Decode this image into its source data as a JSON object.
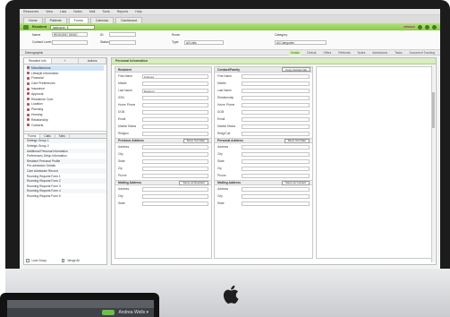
{
  "menubar": [
    "Resources",
    "View",
    "Lists",
    "Notes",
    "Mail",
    "Tools",
    "Reports",
    "Help"
  ],
  "tabs": [
    {
      "label": "Home",
      "active": false
    },
    {
      "label": "Patients",
      "active": false
    },
    {
      "label": "Forms",
      "active": true
    },
    {
      "label": "Calendar",
      "active": false
    },
    {
      "label": "Dashboard",
      "active": false
    }
  ],
  "greenbar": {
    "title": "Resident",
    "input": "lastname, fi",
    "logo": "edvisor"
  },
  "header": {
    "name_label": "Name",
    "name_value": "RESIDENT DEMO",
    "contact_label": "Contact Level",
    "id_label": "ID",
    "status_label": "Status",
    "room_label": "Room",
    "type_label": "Type",
    "type_value": "All Units",
    "cat_label": "Category",
    "cat_value": "All Categories"
  },
  "subtabs": {
    "label": "Demographic",
    "right": [
      {
        "label": "Details",
        "sel": true
      },
      {
        "label": "Clinical",
        "sel": false
      },
      {
        "label": "Offers",
        "sel": false
      },
      {
        "label": "Referrals",
        "sel": false
      },
      {
        "label": "Notes",
        "sel": false
      },
      {
        "label": "Admissions",
        "sel": false
      },
      {
        "label": "Tasks",
        "sel": false
      },
      {
        "label": "Document Tracking",
        "sel": false
      }
    ]
  },
  "sidebar": {
    "tabs": [
      "Resident Info",
      "+",
      "Actions"
    ],
    "items": [
      {
        "label": "Miscellaneous",
        "sel": true
      },
      {
        "label": "Lifestyle Information",
        "sel": false
      },
      {
        "label": "Financial",
        "sel": false
      },
      {
        "label": "Care Preferences",
        "sel": false
      },
      {
        "label": "Insurance",
        "sel": false
      },
      {
        "label": "Approval",
        "sel": false
      },
      {
        "label": "Residence Cont.",
        "sel": false
      },
      {
        "label": "Location",
        "sel": false
      },
      {
        "label": "Planning",
        "sel": false
      },
      {
        "label": "Housing",
        "sel": false
      },
      {
        "label": "Relationship",
        "sel": false
      },
      {
        "label": "Contacts",
        "sel": false
      }
    ],
    "tabs2": [
      "Forms",
      "Calls",
      "Tabs"
    ],
    "rows": [
      "Settings Group 1",
      "Settings Group 2",
      "Additional Personal Information",
      "Preferences Setup Information",
      "Resident Personal Profile",
      "Pre-admission Details",
      "Care Admission Record",
      "Rooming Request Form 1",
      "Rooming Request Form 2",
      "Rooming Request Form 3",
      "Rooming Request Form 4",
      "Rooming Request Form 5"
    ],
    "foot_left": "Lock Group",
    "foot_right": "Merge All"
  },
  "main": {
    "title": "Personal Information",
    "panes": [
      {
        "head": "Resident",
        "btn": "",
        "fields": [
          {
            "k": "First Name",
            "v": "Frances"
          },
          {
            "k": "Middle",
            "v": ""
          },
          {
            "k": "Last Name",
            "v": "Rayburn"
          },
          {
            "k": "SSN",
            "v": ""
          },
          {
            "k": "Home Phone",
            "v": ""
          },
          {
            "k": "DOB",
            "v": ""
          },
          {
            "k": "Email",
            "v": ""
          },
          {
            "k": "Marital Status",
            "v": ""
          },
          {
            "k": "Religion",
            "v": ""
          }
        ],
        "sect1": "Previous Address",
        "sect1_btn": "Move Out Date",
        "fields2": [
          {
            "k": "Address",
            "v": ""
          },
          {
            "k": "City",
            "v": ""
          },
          {
            "k": "State",
            "v": ""
          },
          {
            "k": "Zip",
            "v": ""
          },
          {
            "k": "Phone",
            "v": ""
          }
        ],
        "sect2": "Mailing Address",
        "sect2_btn": "Same as Resident",
        "fields3": [
          {
            "k": "Address",
            "v": ""
          },
          {
            "k": "City",
            "v": ""
          },
          {
            "k": "State",
            "v": ""
          }
        ]
      },
      {
        "head": "Contact/Family",
        "btn": "Copy Contact Info",
        "fields": [
          {
            "k": "First Name",
            "v": ""
          },
          {
            "k": "Middle",
            "v": ""
          },
          {
            "k": "Last Name",
            "v": ""
          },
          {
            "k": "Relationship",
            "v": ""
          },
          {
            "k": "Home Phone",
            "v": ""
          },
          {
            "k": "DOB",
            "v": ""
          },
          {
            "k": "Email",
            "v": ""
          },
          {
            "k": "Marital Status",
            "v": ""
          },
          {
            "k": "Relig/Cult",
            "v": ""
          }
        ],
        "sect1": "Personal Address",
        "sect1_btn": "Move Out Date",
        "fields2": [
          {
            "k": "Address",
            "v": ""
          },
          {
            "k": "City",
            "v": ""
          },
          {
            "k": "State",
            "v": ""
          },
          {
            "k": "Zip",
            "v": ""
          },
          {
            "k": "Phone",
            "v": ""
          }
        ],
        "sect2": "Mailing Address",
        "sect2_btn": "Same as Contact",
        "fields3": [
          {
            "k": "Address",
            "v": ""
          },
          {
            "k": "City",
            "v": ""
          },
          {
            "k": "State",
            "v": ""
          }
        ]
      }
    ]
  }
}
